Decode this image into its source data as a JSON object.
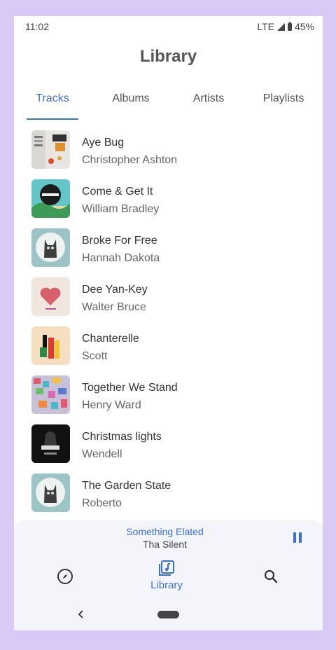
{
  "status_bar": {
    "time": "11:02",
    "network": "LTE",
    "battery": "45%"
  },
  "page": {
    "title": "Library"
  },
  "tabs": [
    {
      "label": "Tracks",
      "active": true
    },
    {
      "label": "Albums",
      "active": false
    },
    {
      "label": "Artists",
      "active": false
    },
    {
      "label": "Playlists",
      "active": false
    }
  ],
  "tracks": [
    {
      "title": "Aye Bug",
      "artist": "Christopher Ashton"
    },
    {
      "title": "Come & Get It",
      "artist": "William Bradley"
    },
    {
      "title": "Broke For Free",
      "artist": "Hannah Dakota"
    },
    {
      "title": "Dee Yan-Key",
      "artist": "Walter Bruce"
    },
    {
      "title": "Chanterelle",
      "artist": "Scott"
    },
    {
      "title": "Together We Stand",
      "artist": "Henry Ward"
    },
    {
      "title": "Christmas lights",
      "artist": "Wendell"
    },
    {
      "title": "The Garden State",
      "artist": "Roberto"
    }
  ],
  "now_playing": {
    "title": "Something Elated",
    "artist": "Tha Silent",
    "state_icon": "pause-icon"
  },
  "bottom_nav": [
    {
      "icon": "compass-icon",
      "label": ""
    },
    {
      "icon": "library-music-icon",
      "label": "Library",
      "active": true
    },
    {
      "icon": "search-icon",
      "label": ""
    }
  ],
  "colors": {
    "accent": "#3b6fd0",
    "frame": "#dac9f6"
  }
}
